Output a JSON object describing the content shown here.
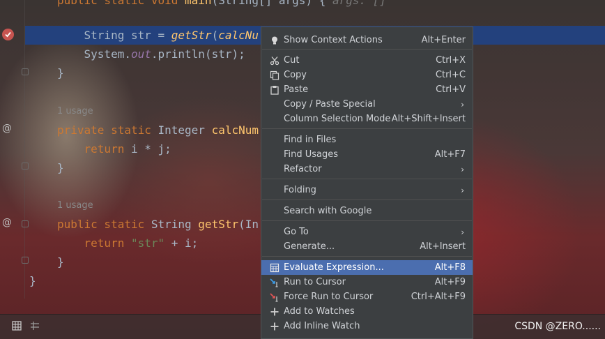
{
  "editor": {
    "lines": [
      {
        "key": "l0",
        "tokens": [
          [
            "kw",
            "public static "
          ],
          [
            "kw",
            "void "
          ],
          [
            "fn",
            "main"
          ],
          [
            "plain",
            "(String[] args) { "
          ],
          [
            "hint",
            "args: []"
          ]
        ]
      },
      {
        "key": "l1",
        "tokens": [
          [
            "plain",
            "    String str = "
          ],
          [
            "it",
            "getStr"
          ],
          [
            "plain",
            "("
          ],
          [
            "it",
            "calcNu"
          ]
        ]
      },
      {
        "key": "l2",
        "tokens": [
          [
            "plain",
            "    System."
          ],
          [
            "field",
            "out"
          ],
          [
            "plain",
            ".println(str);"
          ]
        ]
      },
      {
        "key": "l3",
        "tokens": [
          [
            "plain",
            "}"
          ]
        ]
      },
      {
        "key": "l4",
        "tokens": [
          [
            "kw",
            "private static "
          ],
          [
            "plain",
            "Integer "
          ],
          [
            "fn",
            "calcNum"
          ]
        ]
      },
      {
        "key": "l5",
        "tokens": [
          [
            "plain",
            "    "
          ],
          [
            "kw",
            "return "
          ],
          [
            "plain",
            "i * j;"
          ]
        ]
      },
      {
        "key": "l6",
        "tokens": [
          [
            "plain",
            "}"
          ]
        ]
      },
      {
        "key": "l7",
        "tokens": [
          [
            "kw",
            "public static "
          ],
          [
            "plain",
            "String "
          ],
          [
            "fn",
            "getStr"
          ],
          [
            "plain",
            "(In"
          ]
        ]
      },
      {
        "key": "l8",
        "tokens": [
          [
            "plain",
            "    "
          ],
          [
            "kw",
            "return "
          ],
          [
            "str",
            "\"str\""
          ],
          [
            "plain",
            " + i;"
          ]
        ]
      },
      {
        "key": "l9",
        "tokens": [
          [
            "plain",
            "}"
          ]
        ]
      },
      {
        "key": "l10",
        "tokens": [
          [
            "plain",
            "}"
          ]
        ]
      }
    ],
    "usage_labels": [
      "1 usage",
      "1 usage"
    ],
    "gutter_at_symbol": "@"
  },
  "context_menu": {
    "items": [
      {
        "icon": "bulb-icon",
        "label": "Show Context Actions",
        "shortcut": "Alt+Enter",
        "submenu": false
      },
      {
        "icon": "scissors-icon",
        "label": "Cut",
        "shortcut": "Ctrl+X",
        "submenu": false
      },
      {
        "icon": "copy-icon",
        "label": "Copy",
        "shortcut": "Ctrl+C",
        "submenu": false
      },
      {
        "icon": "paste-icon",
        "label": "Paste",
        "shortcut": "Ctrl+V",
        "submenu": false
      },
      {
        "icon": "",
        "label": "Copy / Paste Special",
        "shortcut": "",
        "submenu": true
      },
      {
        "icon": "",
        "label": "Column Selection Mode",
        "shortcut": "Alt+Shift+Insert",
        "submenu": false
      },
      {
        "icon": "",
        "label": "Find in Files",
        "shortcut": "",
        "submenu": false
      },
      {
        "icon": "",
        "label": "Find Usages",
        "shortcut": "Alt+F7",
        "submenu": false
      },
      {
        "icon": "",
        "label": "Refactor",
        "shortcut": "",
        "submenu": true
      },
      {
        "icon": "",
        "label": "Folding",
        "shortcut": "",
        "submenu": true
      },
      {
        "icon": "",
        "label": "Search with Google",
        "shortcut": "",
        "submenu": false
      },
      {
        "icon": "",
        "label": "Go To",
        "shortcut": "",
        "submenu": true
      },
      {
        "icon": "",
        "label": "Generate...",
        "shortcut": "Alt+Insert",
        "submenu": false
      },
      {
        "icon": "calculator-icon",
        "label": "Evaluate Expression...",
        "shortcut": "Alt+F8",
        "submenu": false,
        "highlighted": true
      },
      {
        "icon": "run-to-cursor-icon",
        "label": "Run to Cursor",
        "shortcut": "Alt+F9",
        "submenu": false
      },
      {
        "icon": "force-run-to-cursor-icon",
        "label": "Force Run to Cursor",
        "shortcut": "Ctrl+Alt+F9",
        "submenu": false
      },
      {
        "icon": "add-watch-icon",
        "label": "Add to Watches",
        "shortcut": "",
        "submenu": false
      },
      {
        "icon": "add-inline-watch-icon",
        "label": "Add Inline Watch",
        "shortcut": "",
        "submenu": false
      }
    ]
  },
  "watermark": "CSDN @ZERO......",
  "colors": {
    "selection": "#214283",
    "menu_bg": "#3c3f41",
    "menu_highlight": "#4b6eaf",
    "keyword": "#cc7832",
    "method": "#ffc66d",
    "string": "#6a8759",
    "breakpoint": "#c75450"
  }
}
